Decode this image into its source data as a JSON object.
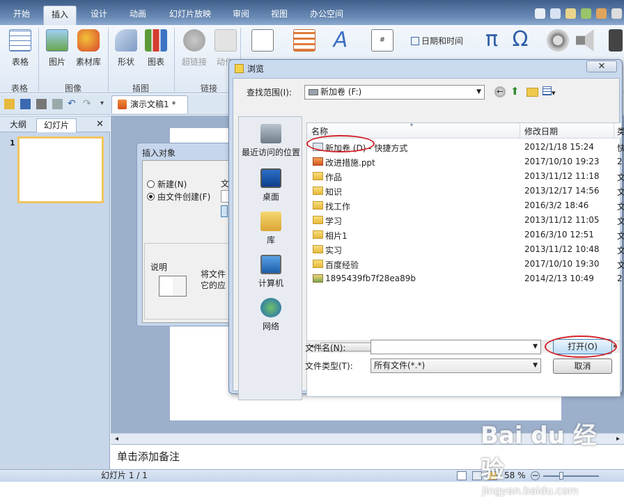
{
  "ribbon_tabs": [
    "开始",
    "插入",
    "设计",
    "动画",
    "幻灯片放映",
    "审阅",
    "视图",
    "办公空间"
  ],
  "ribbon": {
    "buttons": {
      "table": "表格",
      "picture": "图片",
      "clipart": "素材库",
      "shapes": "形状",
      "chart": "图表",
      "hyperlink": "超链接",
      "action": "动作",
      "date_time": "日期和时间"
    },
    "groups": {
      "table": "表格",
      "image": "图像",
      "illustration": "插图",
      "link": "链接"
    }
  },
  "document": {
    "tab_title": "演示文稿1 *"
  },
  "left_panel": {
    "tabs": [
      "大纲",
      "幻灯片"
    ],
    "close": "✕",
    "thumb_number": "1"
  },
  "notes_placeholder": "单击添加备注",
  "status": {
    "slide_info": "幻灯片 1 / 1",
    "zoom": "58 %"
  },
  "insert_dialog": {
    "title": "插入对象",
    "new_option": "新建(N)",
    "from_file_option": "由文件创建(F)",
    "file_label_partial": "文",
    "desc_label": "说明",
    "desc_text_line1": "将文件",
    "desc_text_line2": "它的应"
  },
  "browse_dialog": {
    "title": "浏览",
    "look_in_label": "查找范围(I):",
    "look_in_value": "新加卷 (F:)",
    "places": [
      "最近访问的位置",
      "桌面",
      "库",
      "计算机",
      "网络"
    ],
    "columns": {
      "name": "名称",
      "modified": "修改日期",
      "extra": "类"
    },
    "files": [
      {
        "name": "新加卷 (D) - 快捷方式",
        "date": "2012/1/18 15:24",
        "extra": "快",
        "icon": "shortcut-icon"
      },
      {
        "name": "改进措施.ppt",
        "date": "2017/10/10 19:23",
        "extra": "2",
        "icon": "ppt-file-icon"
      },
      {
        "name": "作品",
        "date": "2013/11/12 11:18",
        "extra": "文",
        "icon": "folder-icon"
      },
      {
        "name": "知识",
        "date": "2013/12/17 14:56",
        "extra": "文",
        "icon": "folder-icon"
      },
      {
        "name": "找工作",
        "date": "2016/3/2 18:46",
        "extra": "文",
        "icon": "folder-icon"
      },
      {
        "name": "学习",
        "date": "2013/11/12 11:05",
        "extra": "文",
        "icon": "folder-icon"
      },
      {
        "name": "相片1",
        "date": "2016/3/10 12:51",
        "extra": "文",
        "icon": "folder-icon"
      },
      {
        "name": "实习",
        "date": "2013/11/12 10:48",
        "extra": "文",
        "icon": "folder-icon"
      },
      {
        "name": "百度经验",
        "date": "2017/10/10 19:30",
        "extra": "文",
        "icon": "folder-icon"
      },
      {
        "name": "1895439fb7f28ea89b",
        "date": "2014/2/13 10:49",
        "extra": "2",
        "icon": "image-file-icon"
      }
    ],
    "filename_label": "文件名(N):",
    "filename_value": "",
    "filetype_label": "文件类型(T):",
    "filetype_value": "所有文件(*.*)",
    "open_button": "打开(O)",
    "cancel_button": "取消"
  },
  "watermark": {
    "brand": "Bai du 经验",
    "url": "jingyan.baidu.com"
  },
  "colors": {
    "highlight_circle": "#d2232a",
    "ribbon_dark": "#3f5f8a",
    "thumb_border": "#f1c660"
  }
}
